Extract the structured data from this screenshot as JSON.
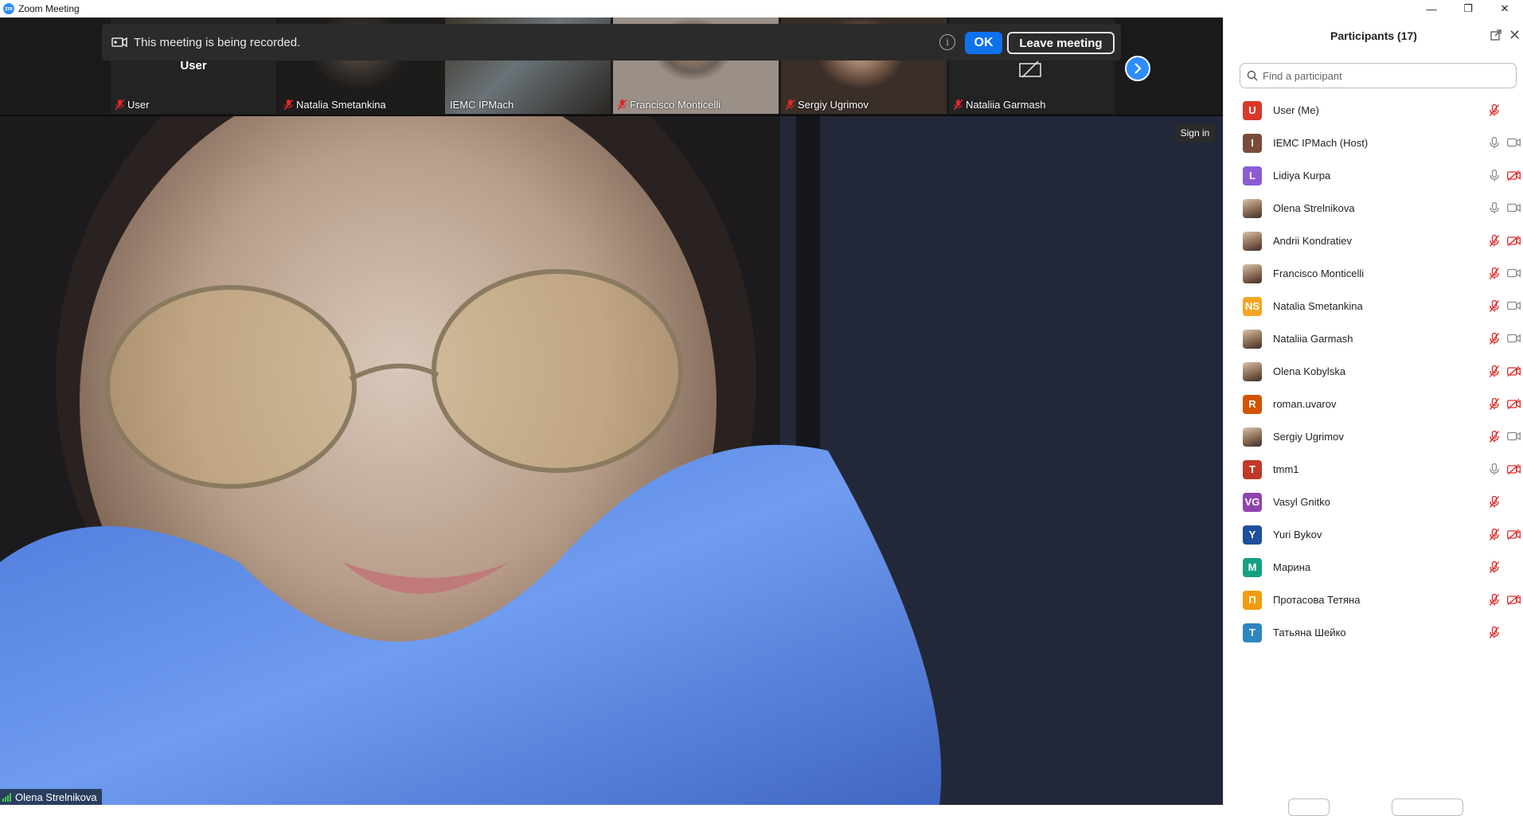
{
  "window": {
    "title": "Zoom Meeting",
    "app_icon_text": "zm",
    "minimize_glyph": "—",
    "restore_glyph": "❐",
    "close_glyph": "✕"
  },
  "banner": {
    "message": "This meeting is being recorded.",
    "info_glyph": "i",
    "ok_label": "OK",
    "leave_label": "Leave meeting"
  },
  "strip": {
    "tiles": [
      {
        "name": "User",
        "center_label": "User",
        "muted": true
      },
      {
        "name": "Natalia Smetankina",
        "muted": true
      },
      {
        "name": "IEMC IPMach",
        "muted": false
      },
      {
        "name": "Francisco Monticelli",
        "muted": true
      },
      {
        "name": "Sergiy Ugrimov",
        "muted": true
      },
      {
        "name": "Nataliia Garmash",
        "muted": true,
        "video_off": true
      }
    ]
  },
  "main_video": {
    "speaker_name": "Olena Strelnikova",
    "sign_in_label": "Sign in"
  },
  "panel": {
    "title": "Participants (17)",
    "close_glyph": "✕",
    "search_placeholder": "Find a participant",
    "participants": [
      {
        "initials": "U",
        "name": "User (Me)",
        "color": "#d8392b",
        "mic": "muted",
        "video": "none"
      },
      {
        "initials": "I",
        "name": "IEMC IPMach (Host)",
        "color": "#7a4b3a",
        "mic": "on",
        "video": "on"
      },
      {
        "initials": "L",
        "name": "Lidiya Kurpa",
        "color": "#8e5bd6",
        "mic": "on",
        "video": "off"
      },
      {
        "initials": "",
        "name": "Olena Strelnikova",
        "color": "#7a5a48",
        "photo": true,
        "mic": "on",
        "video": "on"
      },
      {
        "initials": "",
        "name": "Andrii Kondratiev",
        "color": "#8a6a58",
        "photo": true,
        "mic": "muted",
        "video": "off"
      },
      {
        "initials": "",
        "name": "Francisco Monticelli",
        "color": "#5a6a78",
        "photo": true,
        "mic": "muted",
        "video": "on"
      },
      {
        "initials": "NS",
        "name": "Natalia Smetankina",
        "color": "#f5a623",
        "mic": "muted",
        "video": "on"
      },
      {
        "initials": "",
        "name": "Nataliia Garmash",
        "color": "#a88a60",
        "photo": true,
        "mic": "muted",
        "video": "on"
      },
      {
        "initials": "",
        "name": "Olena Kobylska",
        "color": "#6a4a48",
        "photo": true,
        "mic": "muted",
        "video": "off"
      },
      {
        "initials": "R",
        "name": "roman.uvarov",
        "color": "#d35400",
        "mic": "muted",
        "video": "off"
      },
      {
        "initials": "",
        "name": "Sergiy Ugrimov",
        "color": "#8a7868",
        "photo": true,
        "mic": "muted",
        "video": "on"
      },
      {
        "initials": "T",
        "name": "tmm1",
        "color": "#c0392b",
        "mic": "on",
        "video": "off"
      },
      {
        "initials": "VG",
        "name": "Vasyl Gnitko",
        "color": "#8e44ad",
        "mic": "muted",
        "video": "none"
      },
      {
        "initials": "Y",
        "name": "Yuri Bykov",
        "color": "#1f4e9c",
        "mic": "muted",
        "video": "off"
      },
      {
        "initials": "M",
        "name": "Марина",
        "color": "#16a085",
        "mic": "muted",
        "video": "none"
      },
      {
        "initials": "П",
        "name": "Протасова Тетяна",
        "color": "#f39c12",
        "mic": "muted",
        "video": "off"
      },
      {
        "initials": "T",
        "name": "Татьяна Шейко",
        "color": "#2e86c1",
        "mic": "muted",
        "video": "none"
      }
    ]
  },
  "colors": {
    "accent": "#0e72ed",
    "muted_red": "#e02828",
    "icon_grey": "#8a8a8a"
  }
}
